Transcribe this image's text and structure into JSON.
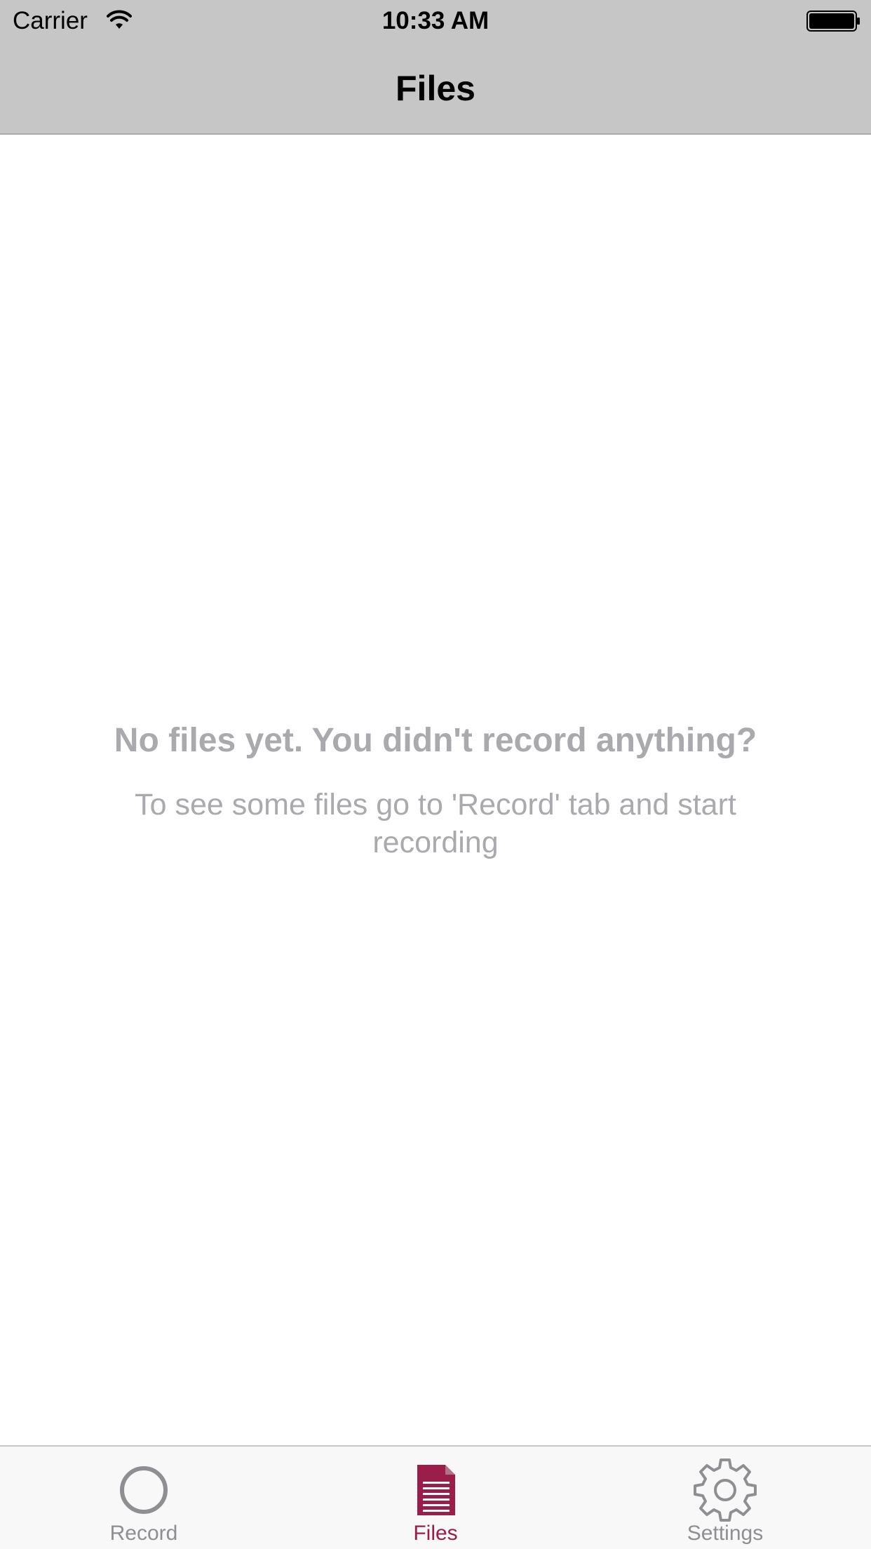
{
  "status_bar": {
    "carrier": "Carrier",
    "time": "10:33 AM",
    "wifi_icon": "wifi-icon",
    "battery_icon": "battery-icon"
  },
  "nav": {
    "title": "Files"
  },
  "empty_state": {
    "title": "No files yet. You didn't record anything?",
    "subtitle": "To see some files go to 'Record' tab and start recording"
  },
  "tabs": [
    {
      "label": "Record",
      "icon": "record-circle-icon",
      "active": false
    },
    {
      "label": "Files",
      "icon": "document-icon",
      "active": true
    },
    {
      "label": "Settings",
      "icon": "gear-icon",
      "active": false
    }
  ],
  "colors": {
    "accent": "#9b1d49",
    "inactive": "#8e8e93",
    "nav_background": "#c6c6c6",
    "placeholder_text": "#a9a9ae"
  }
}
